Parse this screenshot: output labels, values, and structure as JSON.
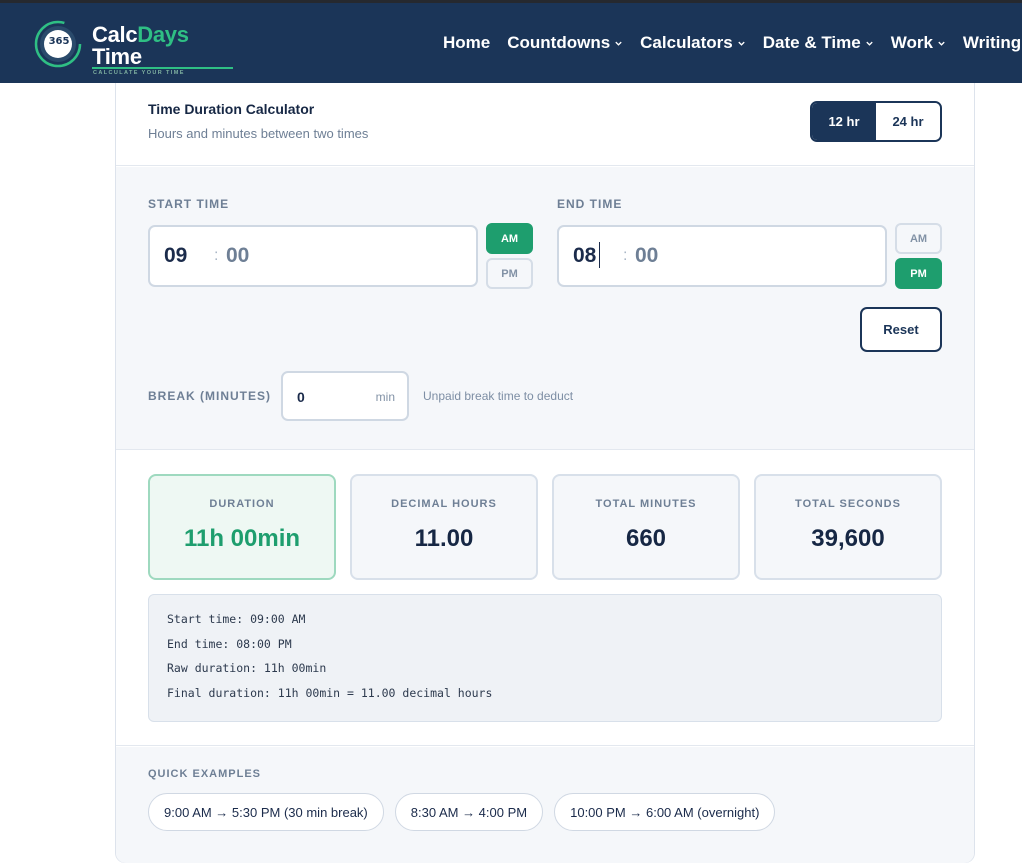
{
  "nav": {
    "logo": {
      "badge": "365",
      "word_calc": "Calc",
      "word_days": "Days",
      "word_time": "Time",
      "tagline": "CALCULATE YOUR TIME"
    },
    "items": [
      {
        "label": "Home",
        "has_dropdown": false
      },
      {
        "label": "Countdowns",
        "has_dropdown": true
      },
      {
        "label": "Calculators",
        "has_dropdown": true
      },
      {
        "label": "Date & Time",
        "has_dropdown": true
      },
      {
        "label": "Work",
        "has_dropdown": true
      },
      {
        "label": "Writing",
        "has_dropdown": false
      }
    ]
  },
  "calculator": {
    "title": "Time Duration Calculator",
    "subtitle": "Hours and minutes between two times",
    "format_toggle": {
      "options": [
        "12 hr",
        "24 hr"
      ],
      "selected": "12 hr"
    },
    "start": {
      "label": "START TIME",
      "hours": "09",
      "minutes": "00",
      "am": "AM",
      "pm": "PM",
      "period": "AM"
    },
    "end": {
      "label": "END TIME",
      "hours": "08",
      "minutes": "00",
      "am": "AM",
      "pm": "PM",
      "period": "PM"
    },
    "reset_label": "Reset",
    "break": {
      "label": "BREAK (MINUTES)",
      "value": "0",
      "unit": "min",
      "hint": "Unpaid break time to deduct"
    }
  },
  "results": {
    "stats": [
      {
        "label": "DURATION",
        "value": "11h 00min",
        "highlight": true
      },
      {
        "label": "DECIMAL HOURS",
        "value": "11.00",
        "highlight": false
      },
      {
        "label": "TOTAL MINUTES",
        "value": "660",
        "highlight": false
      },
      {
        "label": "TOTAL SECONDS",
        "value": "39,600",
        "highlight": false
      }
    ],
    "details": [
      "Start time: 09:00 AM",
      "End time: 08:00 PM",
      "Raw duration: 11h 00min",
      "Final duration: 11h 00min = 11.00 decimal hours"
    ]
  },
  "quick_examples": {
    "label": "QUICK EXAMPLES",
    "chips": [
      "9:00 AM → 5:30 PM (30 min break)",
      "8:30 AM → 4:00 PM",
      "10:00 PM → 6:00 AM (overnight)"
    ]
  },
  "colors": {
    "navy": "#1b3558",
    "green": "#1e9e6e",
    "muted": "#6e7f95"
  }
}
